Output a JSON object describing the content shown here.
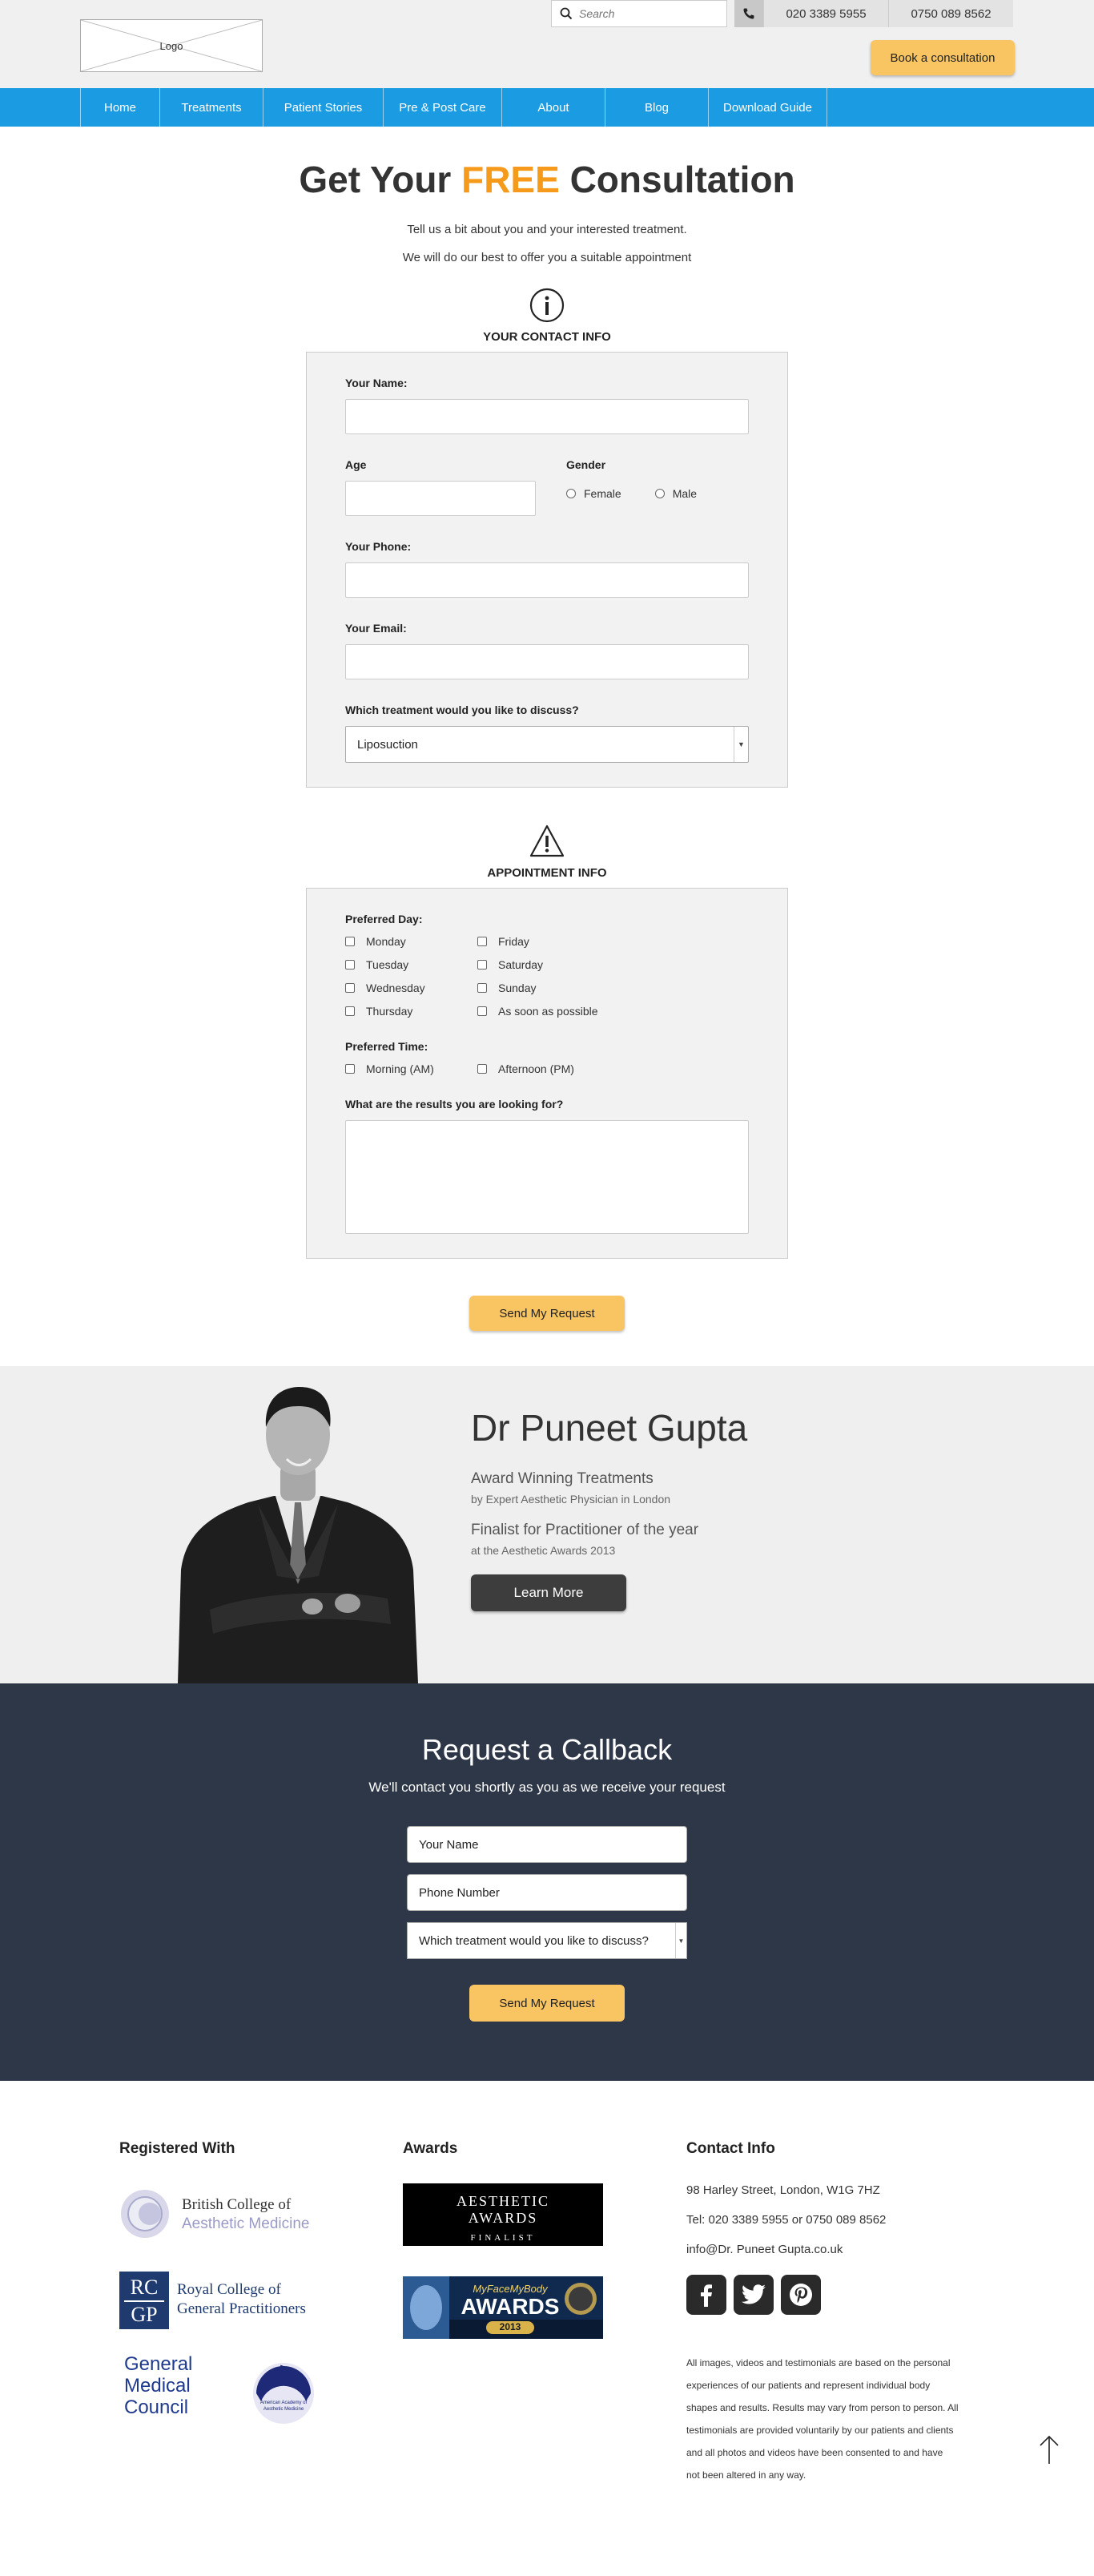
{
  "header": {
    "logo_text": "Logo",
    "search_placeholder": "Search",
    "phone_1": "020 3389 5955",
    "phone_2": "0750 089 8562",
    "book_label": "Book a consultation"
  },
  "nav": {
    "items": [
      "Home",
      "Treatments",
      "Patient Stories",
      "Pre & Post Care",
      "About",
      "Blog",
      "Download Guide"
    ]
  },
  "consultation": {
    "title_pre": "Get Your ",
    "title_free": "FREE",
    "title_post": " Consultation",
    "intro_1": "Tell us a bit about you and your interested treatment.",
    "intro_2": "We will do our best to offer you a suitable appointment",
    "contact_section_title": "YOUR CONTACT INFO",
    "name_label": "Your Name:",
    "age_label": "Age",
    "gender_label": "Gender",
    "gender_female": "Female",
    "gender_male": "Male",
    "phone_label": "Your Phone:",
    "email_label": "Your Email:",
    "treatment_label": "Which treatment would you like to discuss?",
    "treatment_value": "Liposuction",
    "appointment_section_title": "APPOINTMENT INFO",
    "preferred_day_label": "Preferred Day:",
    "days": [
      "Monday",
      "Friday",
      "Tuesday",
      "Saturday",
      "Wednesday",
      "Sunday",
      "Thursday",
      "As soon as possible"
    ],
    "preferred_time_label": "Preferred Time:",
    "times": [
      "Morning (AM)",
      "Afternoon (PM)"
    ],
    "results_label": "What are the results you are looking for?",
    "send_label": "Send My Request"
  },
  "doctor": {
    "name": "Dr Puneet Gupta",
    "line_1": "Award Winning Treatments",
    "sub_1": "by Expert Aesthetic Physician in London",
    "line_2": "Finalist for Practitioner of the year",
    "sub_2": "at the Aesthetic Awards 2013",
    "learn_label": "Learn More"
  },
  "callback": {
    "title": "Request a Callback",
    "subtitle": "We'll contact you shortly as you as we receive your request",
    "name_placeholder": "Your Name",
    "phone_placeholder": "Phone Number",
    "treatment_placeholder": "Which treatment would you like to discuss?",
    "send_label": "Send My Request"
  },
  "footer": {
    "registered_title": "Registered With",
    "awards_title": "Awards",
    "contact_title": "Contact Info",
    "bcam_line_1": "British College of",
    "bcam_line_2": "Aesthetic Medicine",
    "rcgp_letters_1": "RC",
    "rcgp_letters_2": "GP",
    "rcgp_line_1": "Royal College of",
    "rcgp_line_2": "General Practitioners",
    "gmc_line_1": "General",
    "gmc_line_2": "Medical",
    "gmc_line_3": "Council",
    "aaam_text": "American Academy of Aesthetic Medicine",
    "award_1_line_1": "AESTHETIC",
    "award_1_line_2": "AWARDS",
    "award_1_line_3": "FINALIST",
    "award_2_line_1": "MyFaceMyBody",
    "award_2_line_2": "AWARDS",
    "award_2_year": "2013",
    "address": "98 Harley Street, London, W1G 7HZ",
    "tel": "Tel: 020 3389 5955 or 0750 089 8562",
    "email": "info@Dr. Puneet Gupta.co.uk",
    "disclaimer": "All images, videos and testimonials are based on the personal experiences of our patients and represent individual body shapes and results. Results may vary from person to person. All testimonials are provided voluntarily by our patients and clients and all photos and videos have been consented to and have not been altered in any way."
  },
  "colors": {
    "nav_blue": "#1a9be2",
    "accent_orange": "#f59a1b",
    "button_yellow": "#f9c562",
    "callback_bg": "#2e3747"
  }
}
